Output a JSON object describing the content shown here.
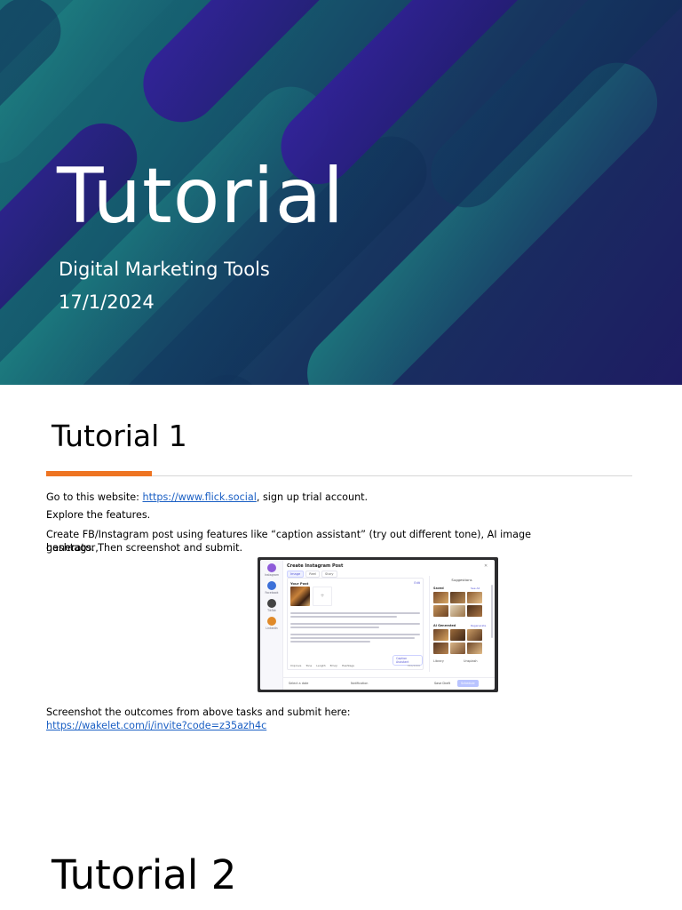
{
  "slide1": {
    "title": "Tutorial",
    "subtitle": "Digital Marketing Tools",
    "date": "17/1/2024"
  },
  "slide2": {
    "title": "Tutorial 1",
    "line1_prefix": "Go to this website: ",
    "line1_link": "https://www.flick.social",
    "line1_suffix": ", sign up trial account.",
    "line2": "Explore the features.",
    "line3a": "Create FB/Instagram post using features like “caption assistant” (try out different tone), AI image generator,",
    "line3b": "hashtags. Then screenshot and submit.",
    "line4": "Screenshot the outcomes from above tasks and submit here:",
    "line4_link": "https://wakelet.com/i/invite?code=z35azh4c"
  },
  "screenshot": {
    "title": "Create Instagram Post",
    "tabs": [
      "Image",
      "Reel",
      "Story"
    ],
    "rail": [
      "Instagram",
      "Facebook",
      "TikTok",
      "LinkedIn"
    ],
    "post_heading": "Your Post",
    "edit_label": "Edit",
    "caption_button": "Caption Assistant",
    "tools": [
      "Improve",
      "Tone",
      "Length",
      "Emoji",
      "Hashtags"
    ],
    "char_count": "350/2200",
    "suggestions_title": "Suggestions",
    "section_saved": "Saved",
    "section_ai": "AI Generated",
    "more_label": "See All",
    "regen_label": "Regenerate",
    "library_label": "Library",
    "unsplash_label": "Unsplash",
    "select_date": "Select a date",
    "notification": "Notification",
    "save_draft": "Save Draft",
    "schedule": "Schedule"
  },
  "slide3": {
    "title": "Tutorial 2"
  }
}
